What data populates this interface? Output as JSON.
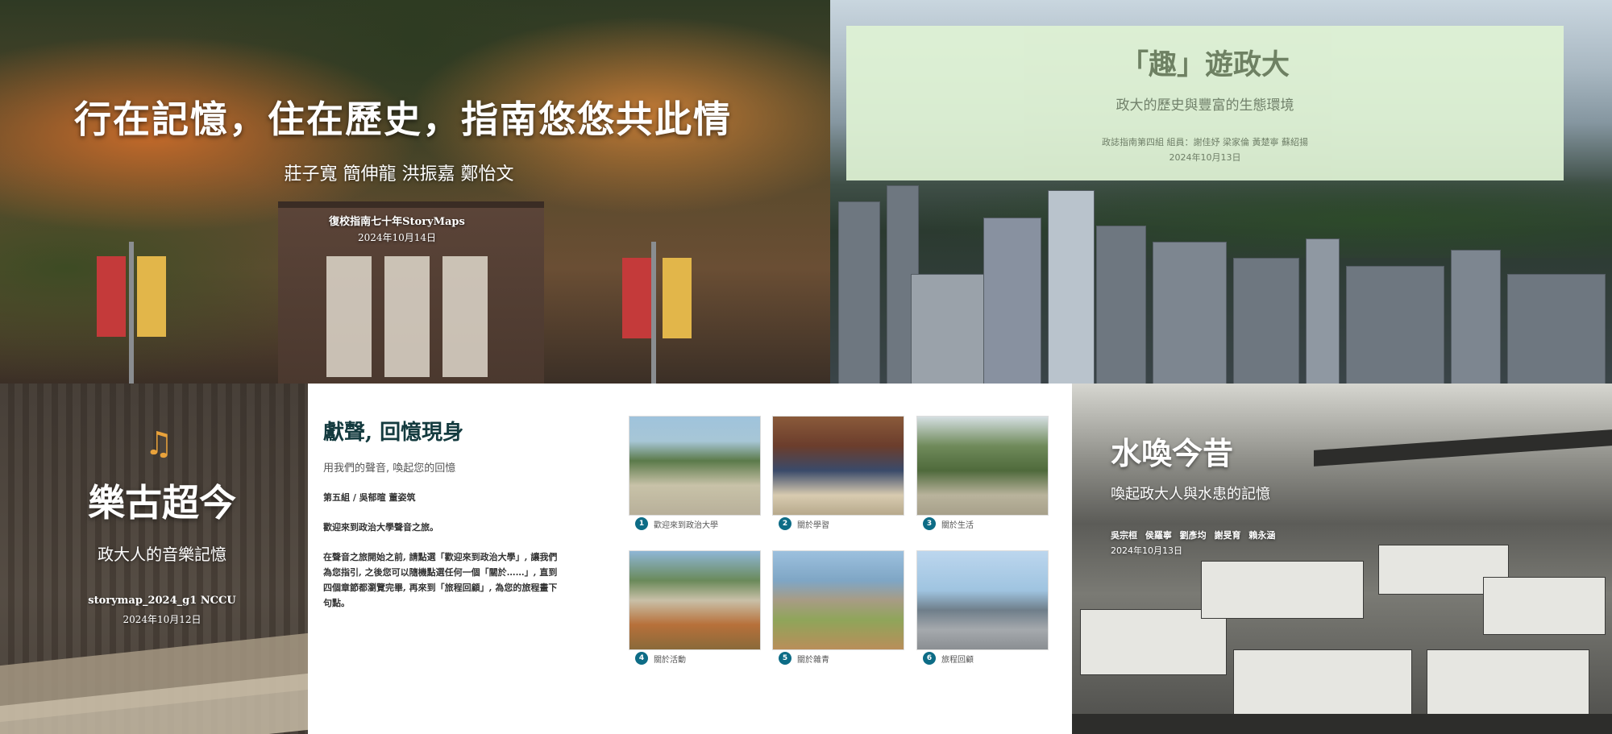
{
  "story1": {
    "title": "行在記憶，住在歷史，指南悠悠共此情",
    "authors": "莊子寬 簡伸龍 洪振嘉 鄭怡文",
    "subtitle": "復校指南七十年StoryMaps",
    "date": "2024年10月14日"
  },
  "story2": {
    "title": "「趣」遊政大",
    "subtitle": "政大的歷史與豐富的生態環境",
    "byline": "政誌指南第四組 組員：謝佳妤 梁家倫 黃楚寧 蘇紹揚",
    "date": "2024年10月13日",
    "card_color": "#dff2d4"
  },
  "story3": {
    "icon": "music-notes-icon",
    "title": "樂古超今",
    "subtitle": "政大人的音樂記憶",
    "byline": "storymap_2024_g1 NCCU",
    "date": "2024年10月12日"
  },
  "story4": {
    "title": "獻聲, 回憶現身",
    "subtitle": "用我們的聲音, 喚起您的回憶",
    "group": "第五組 / 吳郁暄 董姿筑",
    "welcome": "歡迎來到政治大學聲音之旅。",
    "body": "在聲音之旅開始之前, 請點選「歡迎來到政治大學」, 讓我們為您指引, 之後您可以隨機點選任何一個「關於……」, 直到四個章節都瀏覽完畢, 再來到「旅程回顧」, 為您的旅程畫下句點。",
    "accent_color": "#0d6c86",
    "chapters": [
      {
        "num": "1",
        "label": "歡迎來到政治大學"
      },
      {
        "num": "2",
        "label": "關於學習"
      },
      {
        "num": "3",
        "label": "關於生活"
      },
      {
        "num": "4",
        "label": "關於活動"
      },
      {
        "num": "5",
        "label": "關於雜青"
      },
      {
        "num": "6",
        "label": "旅程回顧"
      }
    ]
  },
  "story5": {
    "title": "水喚今昔",
    "subtitle": "喚起政大人與水患的記憶",
    "authors": "吳宗桓 侯羅寧 劉彥均 謝旻育 賴永涵",
    "date": "2024年10月13日"
  }
}
